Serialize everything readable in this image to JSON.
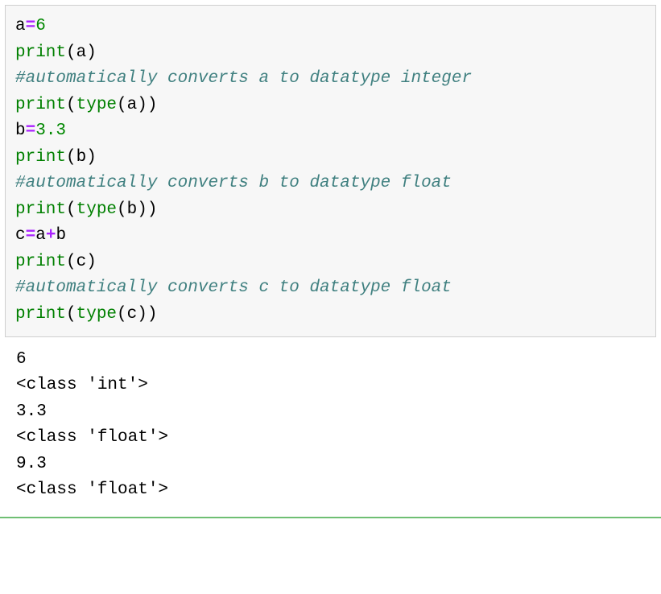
{
  "code": {
    "line1_var": "a",
    "line1_op": "=",
    "line1_val": "6",
    "line2_fn": "print",
    "line2_arg": "a",
    "line3_comment": "#automatically converts a to datatype integer",
    "line4_fn": "print",
    "line4_inner_fn": "type",
    "line4_arg": "a",
    "line5_var": "b",
    "line5_op": "=",
    "line5_val": "3.3",
    "line6_fn": "print",
    "line6_arg": "b",
    "line7_comment": "#automatically converts b to datatype float",
    "line8_fn": "print",
    "line8_inner_fn": "type",
    "line8_arg": "b",
    "line9_var": "c",
    "line9_op": "=",
    "line9_a": "a",
    "line9_plus": "+",
    "line9_b": "b",
    "line10_fn": "print",
    "line10_arg": "c",
    "line11_comment": "#automatically converts c to datatype float",
    "line12_fn": "print",
    "line12_inner_fn": "type",
    "line12_arg": "c"
  },
  "output": {
    "line1": "6",
    "line2": "<class 'int'>",
    "line3": "3.3",
    "line4": "<class 'float'>",
    "line5": "9.3",
    "line6": "<class 'float'>"
  }
}
